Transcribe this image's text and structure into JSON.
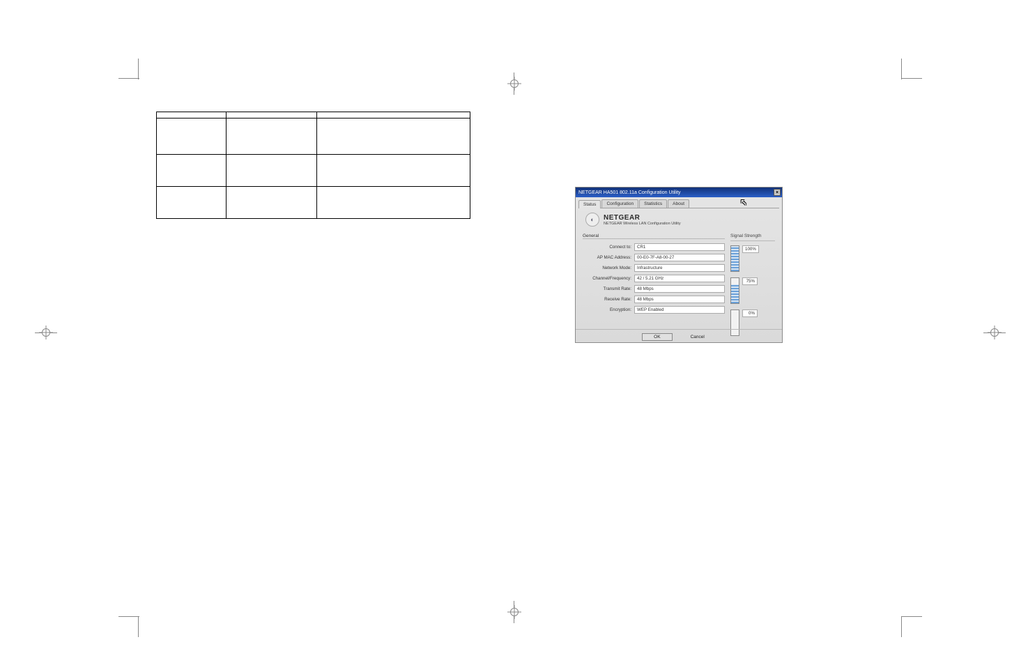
{
  "dialog": {
    "title": "NETGEAR HA501 802.11a Configuration Utility",
    "brand_name": "NETGEAR",
    "brand_sub": "NETGEAR Wireless LAN Configuration Utility",
    "tabs": {
      "status": "Status",
      "configuration": "Configuration",
      "statistics": "Statistics",
      "about": "About"
    },
    "group_general": "General",
    "group_signal": "Signal Strength",
    "fields": {
      "connect_to": {
        "label": "Connect to:",
        "value": "CR1"
      },
      "ap_mac": {
        "label": "AP MAC Address:",
        "value": "00-E0-7F-A8-00-27"
      },
      "network_mode": {
        "label": "Network Mode:",
        "value": "Infrastructure"
      },
      "channel_freq": {
        "label": "Channel/Frequency:",
        "value": "42 / 5.21 GHz"
      },
      "transmit_rate": {
        "label": "Transmit Rate:",
        "value": "48 Mbps"
      },
      "receive_rate": {
        "label": "Receive Rate:",
        "value": "48 Mbps"
      },
      "encryption": {
        "label": "Encryption:",
        "value": "WEP Enabled"
      }
    },
    "signal_levels": [
      "100%",
      "75%",
      "0%"
    ],
    "buttons": {
      "ok": "OK",
      "cancel": "Cancel"
    }
  }
}
